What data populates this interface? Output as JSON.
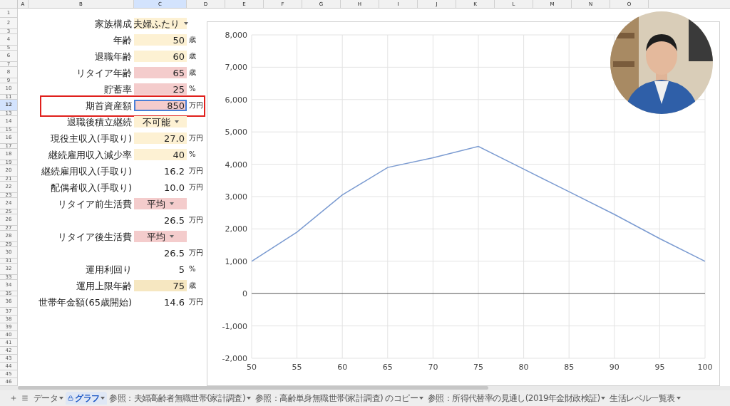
{
  "column_headers": [
    "A",
    "B",
    "C",
    "D",
    "E",
    "F",
    "G",
    "H",
    "I",
    "J",
    "K",
    "L",
    "M",
    "N",
    "O"
  ],
  "row_numbers": [
    "1",
    "2",
    "3",
    "4",
    "5",
    "6",
    "7",
    "8",
    "9",
    "10",
    "11",
    "12",
    "13",
    "14",
    "15",
    "16",
    "17",
    "18",
    "19",
    "20",
    "21",
    "22",
    "23",
    "24",
    "25",
    "26",
    "27",
    "28",
    "29",
    "30",
    "31",
    "32",
    "33",
    "34",
    "35",
    "36",
    "37",
    "38",
    "39",
    "40",
    "41",
    "42",
    "43",
    "44",
    "45",
    "46"
  ],
  "fields": [
    {
      "label": "家族構成",
      "value": "夫婦ふたり",
      "color": "#fdf1d3",
      "dropdown": true,
      "selected": false
    },
    {
      "label": "年齢",
      "value": "50",
      "unit": "歳",
      "color": "#fdf1d3",
      "dropdown": false,
      "selected": false
    },
    {
      "label": "退職年齢",
      "value": "60",
      "unit": "歳",
      "color": "#fdf1d3",
      "dropdown": false,
      "selected": false
    },
    {
      "label": "リタイア年齢",
      "value": "65",
      "unit": "歳",
      "color": "#f4cccc",
      "dropdown": false,
      "selected": false
    },
    {
      "label": "貯蓄率",
      "value": "25",
      "unit": "%",
      "color": "#f4cccc",
      "dropdown": false,
      "selected": false
    },
    {
      "label": "期首資産額",
      "value": "850",
      "unit": "万円",
      "color": "#f4cccc",
      "dropdown": false,
      "selected": true
    },
    {
      "label": "退職後積立継続",
      "value": "不可能",
      "color": "#fdf1d3",
      "dropdown": true,
      "selected": false
    },
    {
      "label": "現役主収入(手取り)",
      "value": "27.0",
      "unit": "万円",
      "color": "#fdf1d3",
      "dropdown": false,
      "selected": false
    },
    {
      "label": "継続雇用収入減少率",
      "value": "40",
      "unit": "%",
      "color": "#fdf1d3",
      "dropdown": false,
      "selected": false
    },
    {
      "label": "継続雇用収入(手取り)",
      "value": "16.2",
      "unit": "万円",
      "dropdown": false,
      "selected": false
    },
    {
      "label": "配偶者収入(手取り)",
      "value": "10.0",
      "unit": "万円",
      "dropdown": false,
      "selected": false
    },
    {
      "label": "リタイア前生活費",
      "value": "平均",
      "color": "#f4cccc",
      "dropdown": true,
      "selected": false
    },
    {
      "value": "26.5",
      "unit": "万円",
      "dropdown": false,
      "selected": false
    },
    {
      "label": "リタイア後生活費",
      "value": "平均",
      "color": "#f4cccc",
      "dropdown": true,
      "selected": false
    },
    {
      "value": "26.5",
      "unit": "万円",
      "dropdown": false,
      "selected": false
    },
    {
      "label": "運用利回り",
      "value": "5",
      "unit": "%",
      "dropdown": false,
      "selected": false
    },
    {
      "label": "運用上限年齢",
      "value": "75",
      "unit": "歳",
      "color": "#f6e7c1",
      "dropdown": false,
      "selected": false
    },
    {
      "label": "世帯年金額(65歳開始)",
      "value": "14.6",
      "unit": "万円",
      "dropdown": false,
      "selected": false
    }
  ],
  "chart": {
    "chart_data": {
      "type": "line",
      "x": [
        50,
        55,
        60,
        65,
        70,
        75,
        80,
        85,
        90,
        95,
        100
      ],
      "grid": true,
      "series": [
        {
          "color": "#7b9bd1",
          "values": [
            1000,
            1900,
            3050,
            3900,
            4200,
            4550,
            3850,
            3150,
            2450,
            1700,
            1000
          ]
        }
      ],
      "xlim": [
        50,
        100
      ],
      "ylim": [
        -2000,
        8000
      ],
      "xticks": [
        50,
        55,
        60,
        65,
        70,
        75,
        80,
        85,
        90,
        95,
        100
      ],
      "yticks": [
        {
          "value": -2000,
          "label": "-2,000"
        },
        {
          "value": -1000,
          "label": "-1,000"
        },
        {
          "value": 0,
          "label": "0"
        },
        {
          "value": 1000,
          "label": "1,000"
        },
        {
          "value": 2000,
          "label": "2,000"
        },
        {
          "value": 3000,
          "label": "3,000"
        },
        {
          "value": 4000,
          "label": "4,000"
        },
        {
          "value": 5000,
          "label": "5,000"
        },
        {
          "value": 6000,
          "label": "6,000"
        },
        {
          "value": 7000,
          "label": "7,000"
        },
        {
          "value": 8000,
          "label": "8,000"
        }
      ]
    }
  },
  "sheet_tabs": [
    {
      "label": "データ",
      "locked": false,
      "selected": false
    },
    {
      "label": "グラフ",
      "locked": true,
      "selected": true
    },
    {
      "label": "参照：夫婦高齢者無職世帯(家計調査)",
      "locked": false,
      "selected": false
    },
    {
      "label": "参照：高齢単身無職世帯(家計調査) のコピー",
      "locked": false,
      "selected": false
    },
    {
      "label": "参照：所得代替率の見通し(2019年金財政検証)",
      "locked": false,
      "selected": false
    },
    {
      "label": "生活レベル一覧表",
      "locked": false,
      "selected": false
    }
  ]
}
